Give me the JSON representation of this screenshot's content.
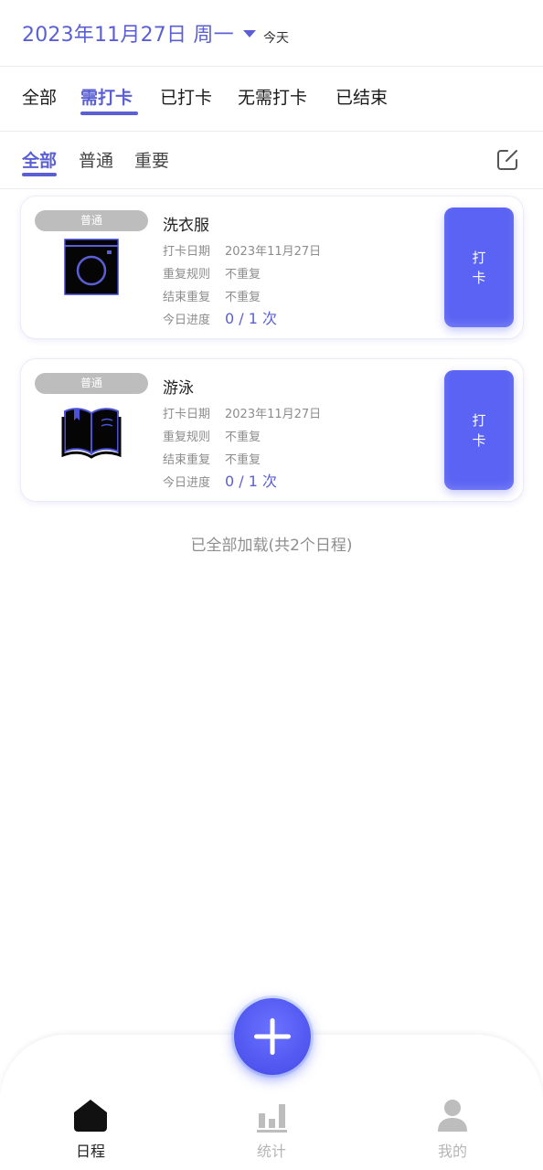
{
  "colors": {
    "accent": "#5a5fd4",
    "button": "#5b63f4",
    "pill": "#bdbdbd",
    "muted": "#8c8c8c"
  },
  "header": {
    "date": "2023年11月27日 周一",
    "dropdown_icon": "caret-down-icon",
    "today_label": "今天"
  },
  "tabs": [
    {
      "label": "全部",
      "active": false
    },
    {
      "label": "需打卡",
      "active": true
    },
    {
      "label": "已打卡",
      "active": false
    },
    {
      "label": "无需打卡",
      "active": false
    },
    {
      "label": "已结束",
      "active": false
    }
  ],
  "subtabs": [
    {
      "label": "全部",
      "active": true
    },
    {
      "label": "普通",
      "active": false
    },
    {
      "label": "重要",
      "active": false
    }
  ],
  "edit_icon": "edit-icon",
  "tasks": [
    {
      "tag": "普通",
      "icon": "washing-machine-icon",
      "title": "洗衣服",
      "date_label": "打卡日期",
      "date": "2023年11月27日",
      "repeat_label": "重复规则",
      "repeat": "不重复",
      "end_label": "结束重复",
      "end": "不重复",
      "progress_label": "今日进度",
      "progress": "0 / 1 次",
      "button_line1": "打",
      "button_line2": "卡"
    },
    {
      "tag": "普通",
      "icon": "open-book-icon",
      "title": "游泳",
      "date_label": "打卡日期",
      "date": "2023年11月27日",
      "repeat_label": "重复规则",
      "repeat": "不重复",
      "end_label": "结束重复",
      "end": "不重复",
      "progress_label": "今日进度",
      "progress": "0 / 1 次",
      "button_line1": "打",
      "button_line2": "卡"
    }
  ],
  "footer_text": "已全部加载(共2个日程)",
  "fab_icon": "plus-icon",
  "nav": [
    {
      "label": "日程",
      "icon": "home-icon",
      "active": true
    },
    {
      "label": "统计",
      "icon": "bar-chart-icon",
      "active": false
    },
    {
      "label": "我的",
      "icon": "user-icon",
      "active": false
    }
  ]
}
